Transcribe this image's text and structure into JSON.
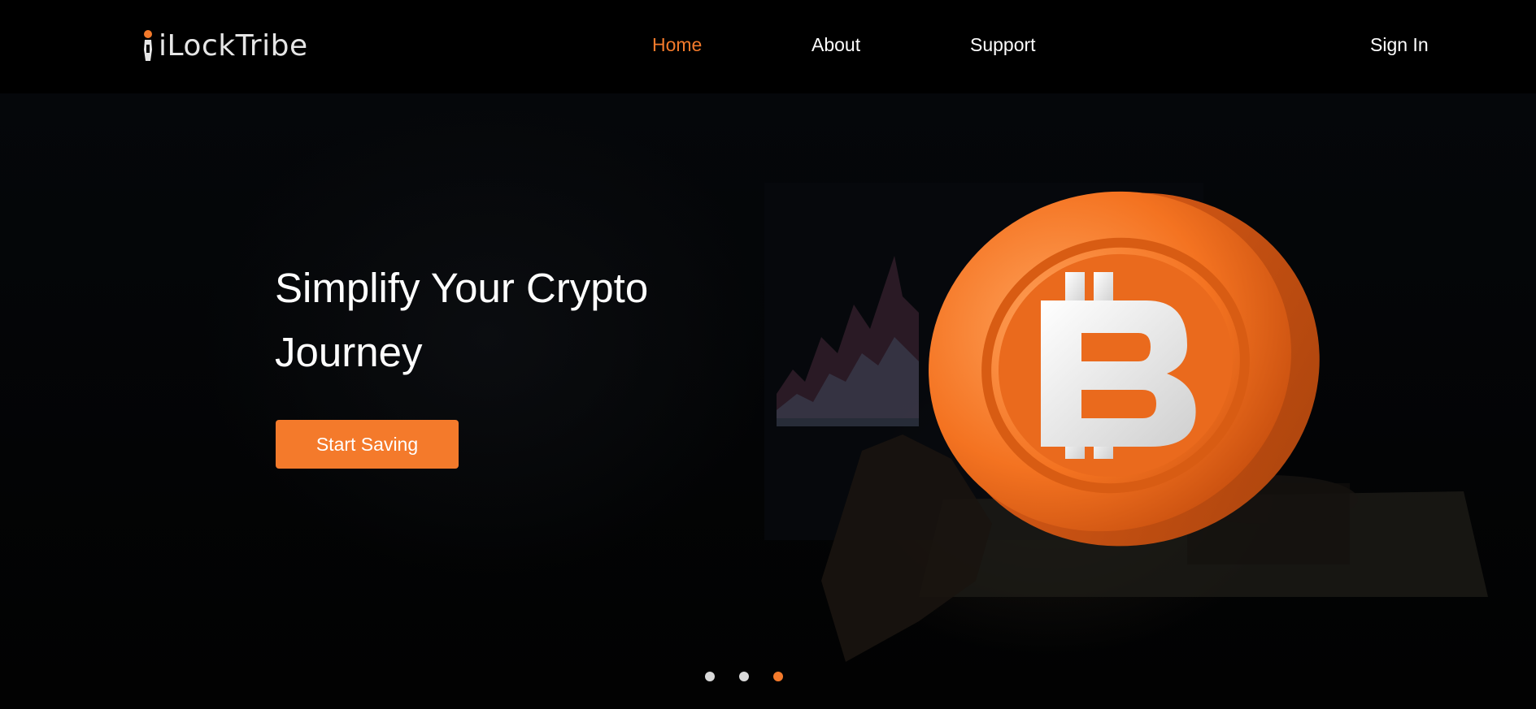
{
  "brand": {
    "name": "iLockTribe",
    "accent_color": "#f47a2b"
  },
  "nav": {
    "links": [
      {
        "label": "Home",
        "active": true
      },
      {
        "label": "About",
        "active": false
      },
      {
        "label": "Support",
        "active": false
      }
    ],
    "signin_label": "Sign In"
  },
  "hero": {
    "title": "Simplify Your Crypto Journey",
    "cta_label": "Start Saving",
    "image_icon": "bitcoin-coin-icon"
  },
  "carousel": {
    "slide_count": 3,
    "active_index": 2
  }
}
